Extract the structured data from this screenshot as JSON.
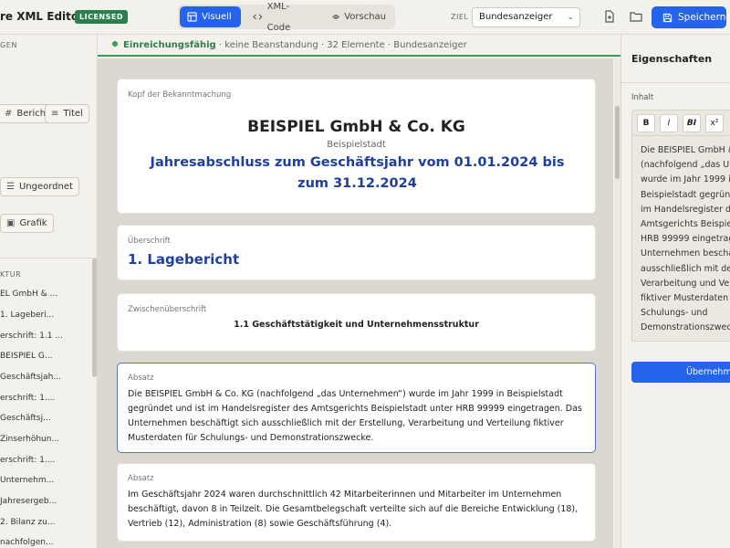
{
  "header": {
    "app_title": "re XML Editor",
    "license_badge": "LICENSED",
    "modes": [
      {
        "label": "Visuell",
        "icon": "layout-icon",
        "active": true
      },
      {
        "label": "XML-Code",
        "icon": "code-icon",
        "active": false
      },
      {
        "label": "Vorschau",
        "icon": "eye-icon",
        "active": false
      }
    ],
    "target_label": "ZIEL",
    "target_value": "Bundesanzeiger",
    "save_label": "Speichern",
    "accent_color": "#2563eb"
  },
  "sidebar": {
    "section_elements": "GEN",
    "buttons": [
      {
        "label": "Bericht",
        "icon": "hash-icon"
      },
      {
        "label": "Titel",
        "icon": "heading-icon"
      },
      {
        "label": "Ungeordnet",
        "icon": "list-icon"
      },
      {
        "label": "Grafik",
        "icon": "image-icon"
      }
    ],
    "section_structure": "KTUR",
    "tree_items": [
      "EL GmbH & ...",
      "1. Lageberi...",
      "erschrift: 1.1 ...",
      "BEISPIEL G...",
      "Geschäftsjah...",
      "erschrift: 1....",
      "Geschäftsj...",
      "Zinserhöhun...",
      "erschrift: 1....",
      "Unternehm...",
      "Jahresergeb...",
      "2. Bilanz zu...",
      "nachfolgen..."
    ]
  },
  "status": {
    "state": "Einreichungsfähig",
    "details": " · keine Beanstandung · 32 Elemente · Bundesanzeiger",
    "ok_color": "#2e9e5a"
  },
  "document": {
    "header_card": {
      "label": "Kopf der Bekanntmachung",
      "company": "BEISPIEL GmbH & Co. KG",
      "city": "Beispielstadt",
      "title": "Jahresabschluss zum Geschäftsjahr vom 01.01.2024 bis zum 31.12.2024"
    },
    "heading_card": {
      "label": "Überschrift",
      "text": "1. Lagebericht"
    },
    "subheading_card": {
      "label": "Zwischenüberschrift",
      "text": "1.1 Geschäftstätigkeit und Unternehmensstruktur"
    },
    "paragraph1": {
      "label": "Absatz",
      "text": "Die BEISPIEL GmbH & Co. KG (nachfolgend „das Unternehmen“) wurde im Jahr 1999 in Beispielstadt gegründet und ist im Handelsregister des Amtsgerichts Beispielstadt unter HRB 99999 eingetragen. Das Unternehmen beschäftigt sich ausschließlich mit der Erstellung, Verarbeitung und Verteilung fiktiver Musterdaten für Schulungs- und Demonstrationszwecke."
    },
    "paragraph2": {
      "label": "Absatz",
      "text": "Im Geschäftsjahr 2024 waren durchschnittlich 42 Mitarbeiterinnen und Mitarbeiter im Unternehmen beschäftigt, davon 8 in Teilzeit. Die Gesamtbelegschaft verteilte sich auf die Bereiche Entwicklung (18), Vertrieb (12), Administration (8) sowie Geschäftsführung (4)."
    }
  },
  "properties": {
    "title": "Eigenschaften",
    "content_label": "Inhalt",
    "format_buttons": [
      "B",
      "I",
      "BI",
      "x²"
    ],
    "editor_lines": [
      "Die BEISPIEL GmbH &",
      "(nachfolgend „das Un",
      "wurde im Jahr 1999 in",
      "Beispielstadt gegrün",
      "im Handelsregister de",
      "Amtsgerichts Beispie",
      "HRB 99999 eingetrag",
      "Unternehmen beschä",
      "ausschließlich mit der",
      "Verarbeitung und Ver",
      "fiktiver Musterdaten f",
      "Schulungs- und",
      "Demonstrationszwec"
    ],
    "apply_label": "Übernehm"
  }
}
